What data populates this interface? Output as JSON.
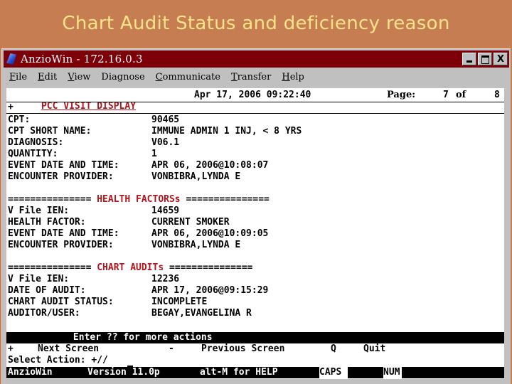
{
  "slide": {
    "title": "Chart Audit Status and deficiency reason"
  },
  "window": {
    "title": "AnzioWin  -  172.16.0.3",
    "buttons": {
      "minimize": "_",
      "maximize": "□",
      "close": "X"
    }
  },
  "menu": [
    {
      "label": "File",
      "accel": "F",
      "rest": "ile"
    },
    {
      "label": "Edit",
      "accel": "E",
      "rest": "dit"
    },
    {
      "label": "View",
      "accel": "V",
      "rest": "iew"
    },
    {
      "label": "Diagnose",
      "accel": "",
      "rest": "Diagnose"
    },
    {
      "label": "Communicate",
      "accel": "C",
      "rest": "ommunicate"
    },
    {
      "label": "Transfer",
      "accel": "T",
      "rest": "ransfer"
    },
    {
      "label": "Help",
      "accel": "H",
      "rest": "elp"
    }
  ],
  "header": {
    "screen_title": "PCC VISIT DISPLAY",
    "datetime": "Apr 17, 2006 09:22:40",
    "page_label": "Page:",
    "page_current": "7",
    "page_of": "of",
    "page_total": "8",
    "more_indicator": "+"
  },
  "visit": [
    {
      "label": "CPT:",
      "value": "90465"
    },
    {
      "label": "CPT SHORT NAME:",
      "value": "IMMUNE ADMIN 1 INJ, < 8 YRS"
    },
    {
      "label": "DIAGNOSIS:",
      "value": "V06.1"
    },
    {
      "label": "QUANTITY:",
      "value": "1"
    },
    {
      "label": "EVENT DATE AND TIME:",
      "value": "APR 06, 2006@10:08:07"
    },
    {
      "label": "ENCOUNTER PROVIDER:",
      "value": "VONBIBRA,LYNDA E"
    }
  ],
  "health_factors": {
    "rule_left": "===============",
    "title": "HEALTH FACTORSs",
    "rule_right": "===============",
    "rows": [
      {
        "label": "V File IEN:",
        "value": "14659"
      },
      {
        "label": "HEALTH FACTOR:",
        "value": "CURRENT SMOKER"
      },
      {
        "label": "EVENT DATE AND TIME:",
        "value": "APR 06, 2006@10:09:05"
      },
      {
        "label": "ENCOUNTER PROVIDER:",
        "value": "VONBIBRA,LYNDA E"
      }
    ]
  },
  "chart_audits": {
    "rule_left": "===============",
    "title": "CHART AUDITs",
    "rule_right": "===============",
    "rows": [
      {
        "label": "V File IEN:",
        "value": "12236"
      },
      {
        "label": "DATE OF AUDIT:",
        "value": "APR 17, 2006@09:15:29"
      },
      {
        "label": "CHART AUDIT STATUS:",
        "value": "INCOMPLETE"
      },
      {
        "label": "AUDITOR/USER:",
        "value": "BEGAY,EVANGELINA R"
      }
    ]
  },
  "actions": {
    "prompt_bar": "            Enter ?? for more actions",
    "next_key": "+",
    "next_label": "Next Screen",
    "prev_key": "-",
    "prev_label": "Previous Screen",
    "quit_key": "Q",
    "quit_label": "Quit",
    "select_label": "Select Action:",
    "select_value": "+//"
  },
  "statusbar": {
    "app": "AnzioWin",
    "version": "Version 11.0p",
    "help": "alt-M for HELP",
    "caps": "CAPS",
    "num": "NUM"
  }
}
